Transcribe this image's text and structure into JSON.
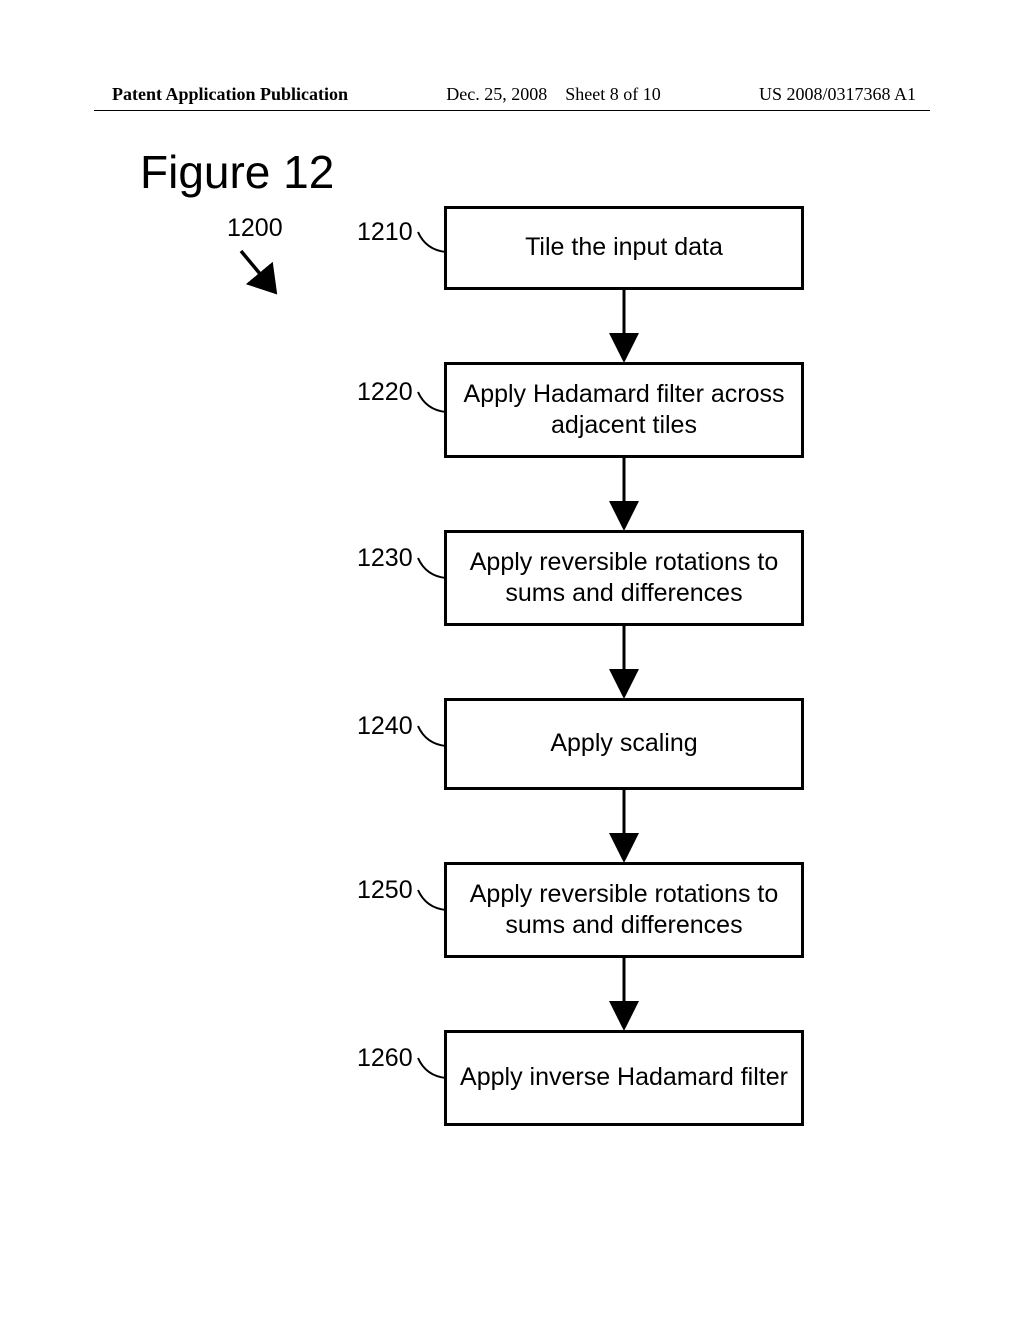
{
  "header": {
    "left": "Patent Application Publication",
    "date": "Dec. 25, 2008",
    "sheet": "Sheet 8 of 10",
    "pubno": "US 2008/0317368 A1"
  },
  "figure": {
    "title": "Figure 12",
    "overall_ref": "1200"
  },
  "steps": [
    {
      "ref": "1210",
      "text": "Tile the input data"
    },
    {
      "ref": "1220",
      "text": "Apply Hadamard filter across adjacent tiles"
    },
    {
      "ref": "1230",
      "text": "Apply reversible rotations to sums and differences"
    },
    {
      "ref": "1240",
      "text": "Apply scaling"
    },
    {
      "ref": "1250",
      "text": "Apply reversible rotations to sums and differences"
    },
    {
      "ref": "1260",
      "text": "Apply inverse Hadamard filter"
    }
  ]
}
